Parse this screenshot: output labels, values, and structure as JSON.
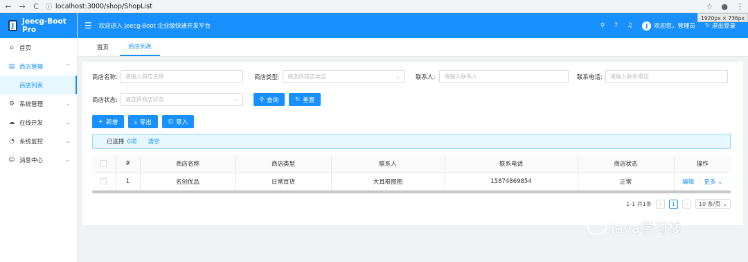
{
  "browser": {
    "url": "localhost:3000/shop/ShopList",
    "size_hint": "1920px × 736px"
  },
  "sidebar": {
    "logo_text": "Jeecg-Boot Pro",
    "logo_letter": "J",
    "items": [
      {
        "label": "首页",
        "icon": "home-icon"
      },
      {
        "label": "商店管理",
        "icon": "shop-icon",
        "open": true
      },
      {
        "label": "系统管理",
        "icon": "gear-icon"
      },
      {
        "label": "在线开发",
        "icon": "cloud-icon"
      },
      {
        "label": "系统监控",
        "icon": "dashboard-icon"
      },
      {
        "label": "消息中心",
        "icon": "message-icon"
      }
    ],
    "sub_item": "商店列表"
  },
  "header": {
    "welcome": "欢迎进入 Jeecg-Boot 企业级快速开发平台",
    "user_greeting": "欢迎您，管理员",
    "logout": "退出登录"
  },
  "tabs": [
    {
      "label": "首页"
    },
    {
      "label": "商店列表",
      "active": true
    }
  ],
  "search": {
    "name_label": "商店名称:",
    "name_placeholder": "请输入商店名称",
    "type_label": "商店类型:",
    "type_placeholder": "请选择商店类型",
    "contact_label": "联系人:",
    "contact_placeholder": "请输入联系人",
    "phone_label": "联系电话:",
    "phone_placeholder": "请输入联系电话",
    "status_label": "商店状态:",
    "status_placeholder": "请选择商店状态",
    "query_btn": "查询",
    "reset_btn": "重置"
  },
  "toolbar": {
    "add": "新增",
    "export": "导出",
    "import": "导入"
  },
  "selection": {
    "prefix": "已选择",
    "count": "0项",
    "clear": "清空"
  },
  "table": {
    "columns": [
      "#",
      "商店名称",
      "商店类型",
      "联系人",
      "联系电话",
      "商店状态",
      "操作"
    ],
    "rows": [
      {
        "index": "1",
        "name": "名创优品",
        "type": "日常百货",
        "contact": "大耳根图图",
        "phone": "15874869854",
        "status": "正常",
        "edit": "编辑",
        "more": "更多"
      }
    ]
  },
  "pager": {
    "summary": "1-1 共1条",
    "current": "1",
    "page_size": "10 条/页"
  },
  "watermark": "Java学习栈",
  "colors": {
    "primary": "#1890ff",
    "alert_bg": "#e6f7ff"
  }
}
